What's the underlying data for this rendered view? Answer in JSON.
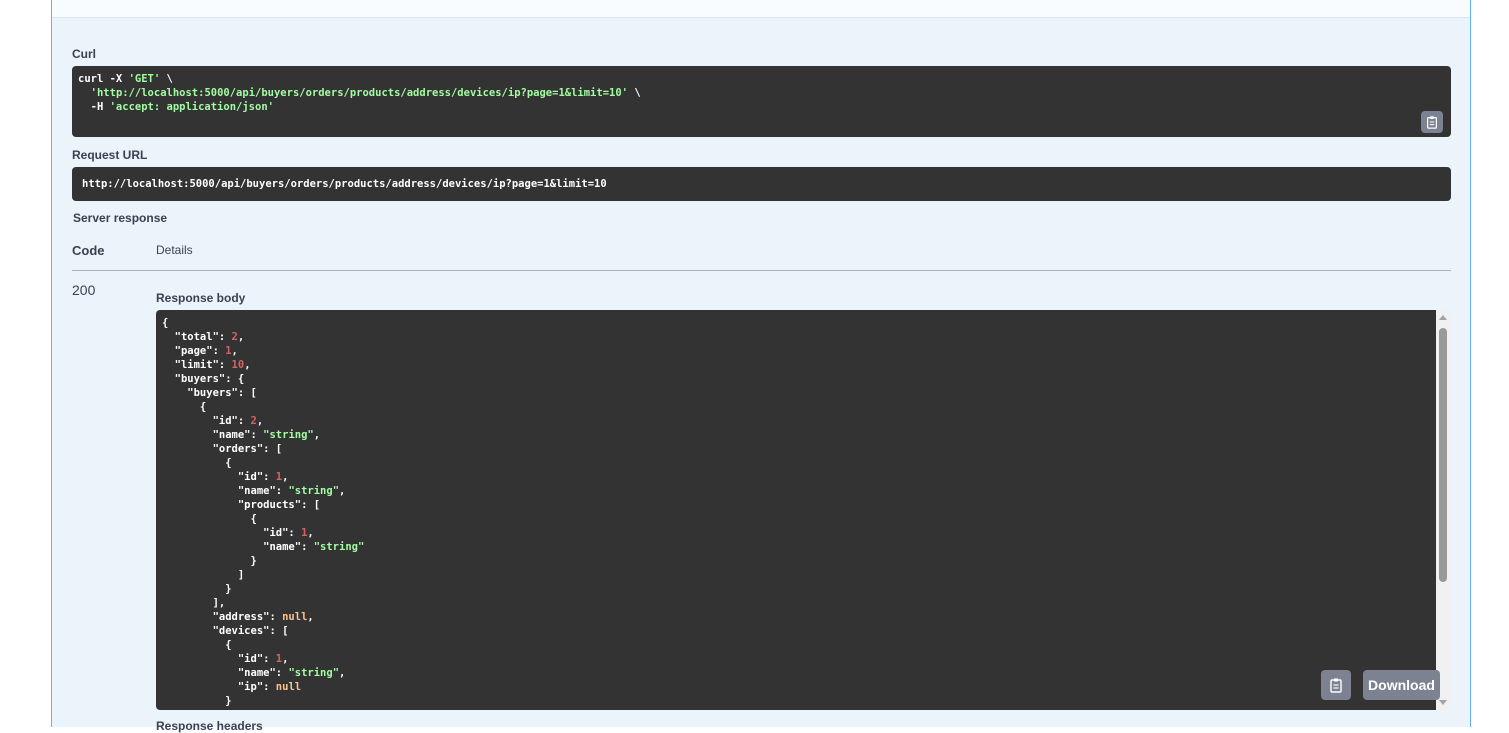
{
  "curl": {
    "label": "Curl",
    "lines": [
      [
        "curl -X ",
        "'GET'",
        " \\"
      ],
      [
        "  ",
        "'http://localhost:5000/api/buyers/orders/products/address/devices/ip?page=1&limit=10'",
        " \\"
      ],
      [
        "  -H ",
        "'accept: application/json'",
        ""
      ]
    ],
    "copy_icon": "clipboard-icon"
  },
  "request_url": {
    "label": "Request URL",
    "value": "http://localhost:5000/api/buyers/orders/products/address/devices/ip?page=1&limit=10"
  },
  "server_response": {
    "label": "Server response",
    "code_header": "Code",
    "details_header": "Details",
    "code": "200",
    "response_body_label": "Response body",
    "response_headers_label": "Response headers",
    "download_label": "Download",
    "body_lines": [
      [
        [
          "p",
          "{"
        ]
      ],
      [
        [
          "p",
          "  \"total\": "
        ],
        [
          "n",
          "2"
        ],
        [
          "p",
          ","
        ]
      ],
      [
        [
          "p",
          "  \"page\": "
        ],
        [
          "n",
          "1"
        ],
        [
          "p",
          ","
        ]
      ],
      [
        [
          "p",
          "  \"limit\": "
        ],
        [
          "n",
          "10"
        ],
        [
          "p",
          ","
        ]
      ],
      [
        [
          "p",
          "  \"buyers\": {"
        ]
      ],
      [
        [
          "p",
          "    \"buyers\": ["
        ]
      ],
      [
        [
          "p",
          "      {"
        ]
      ],
      [
        [
          "p",
          "        \"id\": "
        ],
        [
          "n",
          "2"
        ],
        [
          "p",
          ","
        ]
      ],
      [
        [
          "p",
          "        \"name\": "
        ],
        [
          "s",
          "\"string\""
        ],
        [
          "p",
          ","
        ]
      ],
      [
        [
          "p",
          "        \"orders\": ["
        ]
      ],
      [
        [
          "p",
          "          {"
        ]
      ],
      [
        [
          "p",
          "            \"id\": "
        ],
        [
          "n",
          "1"
        ],
        [
          "p",
          ","
        ]
      ],
      [
        [
          "p",
          "            \"name\": "
        ],
        [
          "s",
          "\"string\""
        ],
        [
          "p",
          ","
        ]
      ],
      [
        [
          "p",
          "            \"products\": ["
        ]
      ],
      [
        [
          "p",
          "              {"
        ]
      ],
      [
        [
          "p",
          "                \"id\": "
        ],
        [
          "n",
          "1"
        ],
        [
          "p",
          ","
        ]
      ],
      [
        [
          "p",
          "                \"name\": "
        ],
        [
          "s",
          "\"string\""
        ]
      ],
      [
        [
          "p",
          "              }"
        ]
      ],
      [
        [
          "p",
          "            ]"
        ]
      ],
      [
        [
          "p",
          "          }"
        ]
      ],
      [
        [
          "p",
          "        ],"
        ]
      ],
      [
        [
          "p",
          "        \"address\": "
        ],
        [
          "k",
          "null"
        ],
        [
          "p",
          ","
        ]
      ],
      [
        [
          "p",
          "        \"devices\": ["
        ]
      ],
      [
        [
          "p",
          "          {"
        ]
      ],
      [
        [
          "p",
          "            \"id\": "
        ],
        [
          "n",
          "1"
        ],
        [
          "p",
          ","
        ]
      ],
      [
        [
          "p",
          "            \"name\": "
        ],
        [
          "s",
          "\"string\""
        ],
        [
          "p",
          ","
        ]
      ],
      [
        [
          "p",
          "            \"ip\": "
        ],
        [
          "k",
          "null"
        ]
      ],
      [
        [
          "p",
          "          }"
        ]
      ]
    ]
  }
}
